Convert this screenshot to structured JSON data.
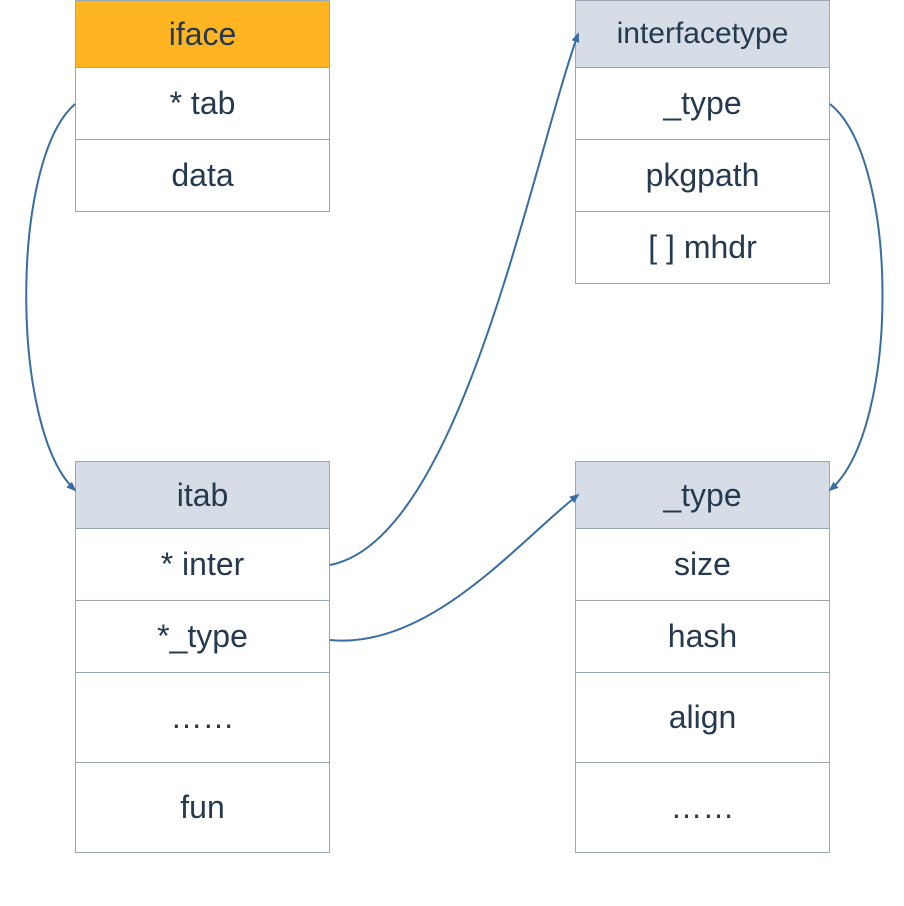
{
  "structs": {
    "iface": {
      "title": "iface",
      "fields": [
        "* tab",
        "data"
      ]
    },
    "interfacetype": {
      "title": "interfacetype",
      "fields": [
        "_type",
        "pkgpath",
        "[ ] mhdr"
      ]
    },
    "itab": {
      "title": "itab",
      "fields": [
        "* inter",
        "*_type",
        "……",
        "fun"
      ]
    },
    "_type": {
      "title": "_type",
      "fields": [
        "size",
        "hash",
        "align",
        "……"
      ]
    }
  },
  "colors": {
    "border": "#9aa7b5",
    "header_bg": "#d6dde6",
    "accent_bg": "#ffb522",
    "text": "#25394f",
    "arrow": "#376da1"
  }
}
